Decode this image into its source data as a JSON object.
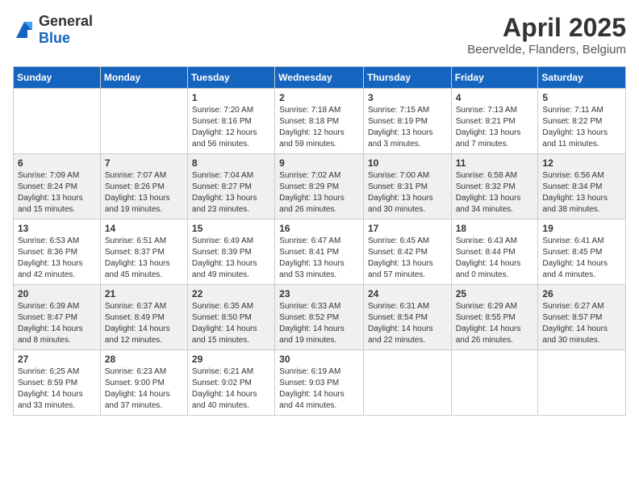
{
  "header": {
    "logo_general": "General",
    "logo_blue": "Blue",
    "month": "April 2025",
    "location": "Beervelde, Flanders, Belgium"
  },
  "days_of_week": [
    "Sunday",
    "Monday",
    "Tuesday",
    "Wednesday",
    "Thursday",
    "Friday",
    "Saturday"
  ],
  "weeks": [
    [
      {
        "day": "",
        "sunrise": "",
        "sunset": "",
        "daylight": ""
      },
      {
        "day": "",
        "sunrise": "",
        "sunset": "",
        "daylight": ""
      },
      {
        "day": "1",
        "sunrise": "Sunrise: 7:20 AM",
        "sunset": "Sunset: 8:16 PM",
        "daylight": "Daylight: 12 hours and 56 minutes."
      },
      {
        "day": "2",
        "sunrise": "Sunrise: 7:18 AM",
        "sunset": "Sunset: 8:18 PM",
        "daylight": "Daylight: 12 hours and 59 minutes."
      },
      {
        "day": "3",
        "sunrise": "Sunrise: 7:15 AM",
        "sunset": "Sunset: 8:19 PM",
        "daylight": "Daylight: 13 hours and 3 minutes."
      },
      {
        "day": "4",
        "sunrise": "Sunrise: 7:13 AM",
        "sunset": "Sunset: 8:21 PM",
        "daylight": "Daylight: 13 hours and 7 minutes."
      },
      {
        "day": "5",
        "sunrise": "Sunrise: 7:11 AM",
        "sunset": "Sunset: 8:22 PM",
        "daylight": "Daylight: 13 hours and 11 minutes."
      }
    ],
    [
      {
        "day": "6",
        "sunrise": "Sunrise: 7:09 AM",
        "sunset": "Sunset: 8:24 PM",
        "daylight": "Daylight: 13 hours and 15 minutes."
      },
      {
        "day": "7",
        "sunrise": "Sunrise: 7:07 AM",
        "sunset": "Sunset: 8:26 PM",
        "daylight": "Daylight: 13 hours and 19 minutes."
      },
      {
        "day": "8",
        "sunrise": "Sunrise: 7:04 AM",
        "sunset": "Sunset: 8:27 PM",
        "daylight": "Daylight: 13 hours and 23 minutes."
      },
      {
        "day": "9",
        "sunrise": "Sunrise: 7:02 AM",
        "sunset": "Sunset: 8:29 PM",
        "daylight": "Daylight: 13 hours and 26 minutes."
      },
      {
        "day": "10",
        "sunrise": "Sunrise: 7:00 AM",
        "sunset": "Sunset: 8:31 PM",
        "daylight": "Daylight: 13 hours and 30 minutes."
      },
      {
        "day": "11",
        "sunrise": "Sunrise: 6:58 AM",
        "sunset": "Sunset: 8:32 PM",
        "daylight": "Daylight: 13 hours and 34 minutes."
      },
      {
        "day": "12",
        "sunrise": "Sunrise: 6:56 AM",
        "sunset": "Sunset: 8:34 PM",
        "daylight": "Daylight: 13 hours and 38 minutes."
      }
    ],
    [
      {
        "day": "13",
        "sunrise": "Sunrise: 6:53 AM",
        "sunset": "Sunset: 8:36 PM",
        "daylight": "Daylight: 13 hours and 42 minutes."
      },
      {
        "day": "14",
        "sunrise": "Sunrise: 6:51 AM",
        "sunset": "Sunset: 8:37 PM",
        "daylight": "Daylight: 13 hours and 45 minutes."
      },
      {
        "day": "15",
        "sunrise": "Sunrise: 6:49 AM",
        "sunset": "Sunset: 8:39 PM",
        "daylight": "Daylight: 13 hours and 49 minutes."
      },
      {
        "day": "16",
        "sunrise": "Sunrise: 6:47 AM",
        "sunset": "Sunset: 8:41 PM",
        "daylight": "Daylight: 13 hours and 53 minutes."
      },
      {
        "day": "17",
        "sunrise": "Sunrise: 6:45 AM",
        "sunset": "Sunset: 8:42 PM",
        "daylight": "Daylight: 13 hours and 57 minutes."
      },
      {
        "day": "18",
        "sunrise": "Sunrise: 6:43 AM",
        "sunset": "Sunset: 8:44 PM",
        "daylight": "Daylight: 14 hours and 0 minutes."
      },
      {
        "day": "19",
        "sunrise": "Sunrise: 6:41 AM",
        "sunset": "Sunset: 8:45 PM",
        "daylight": "Daylight: 14 hours and 4 minutes."
      }
    ],
    [
      {
        "day": "20",
        "sunrise": "Sunrise: 6:39 AM",
        "sunset": "Sunset: 8:47 PM",
        "daylight": "Daylight: 14 hours and 8 minutes."
      },
      {
        "day": "21",
        "sunrise": "Sunrise: 6:37 AM",
        "sunset": "Sunset: 8:49 PM",
        "daylight": "Daylight: 14 hours and 12 minutes."
      },
      {
        "day": "22",
        "sunrise": "Sunrise: 6:35 AM",
        "sunset": "Sunset: 8:50 PM",
        "daylight": "Daylight: 14 hours and 15 minutes."
      },
      {
        "day": "23",
        "sunrise": "Sunrise: 6:33 AM",
        "sunset": "Sunset: 8:52 PM",
        "daylight": "Daylight: 14 hours and 19 minutes."
      },
      {
        "day": "24",
        "sunrise": "Sunrise: 6:31 AM",
        "sunset": "Sunset: 8:54 PM",
        "daylight": "Daylight: 14 hours and 22 minutes."
      },
      {
        "day": "25",
        "sunrise": "Sunrise: 6:29 AM",
        "sunset": "Sunset: 8:55 PM",
        "daylight": "Daylight: 14 hours and 26 minutes."
      },
      {
        "day": "26",
        "sunrise": "Sunrise: 6:27 AM",
        "sunset": "Sunset: 8:57 PM",
        "daylight": "Daylight: 14 hours and 30 minutes."
      }
    ],
    [
      {
        "day": "27",
        "sunrise": "Sunrise: 6:25 AM",
        "sunset": "Sunset: 8:59 PM",
        "daylight": "Daylight: 14 hours and 33 minutes."
      },
      {
        "day": "28",
        "sunrise": "Sunrise: 6:23 AM",
        "sunset": "Sunset: 9:00 PM",
        "daylight": "Daylight: 14 hours and 37 minutes."
      },
      {
        "day": "29",
        "sunrise": "Sunrise: 6:21 AM",
        "sunset": "Sunset: 9:02 PM",
        "daylight": "Daylight: 14 hours and 40 minutes."
      },
      {
        "day": "30",
        "sunrise": "Sunrise: 6:19 AM",
        "sunset": "Sunset: 9:03 PM",
        "daylight": "Daylight: 14 hours and 44 minutes."
      },
      {
        "day": "",
        "sunrise": "",
        "sunset": "",
        "daylight": ""
      },
      {
        "day": "",
        "sunrise": "",
        "sunset": "",
        "daylight": ""
      },
      {
        "day": "",
        "sunrise": "",
        "sunset": "",
        "daylight": ""
      }
    ]
  ]
}
